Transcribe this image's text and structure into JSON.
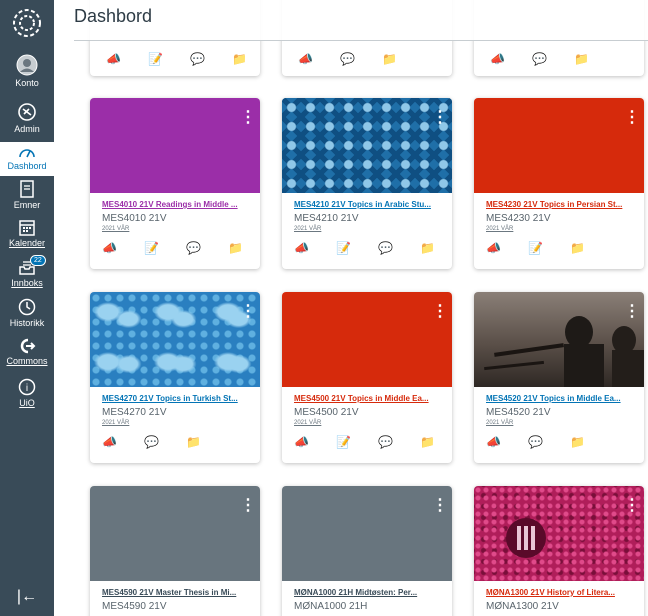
{
  "nav": {
    "account": "Konto",
    "admin": "Admin",
    "dashboard": "Dashbord",
    "courses": "Emner",
    "calendar": "Kalender",
    "inbox": "Innboks",
    "inbox_badge": "22",
    "history": "Historikk",
    "commons": "Commons",
    "uio": "UiO"
  },
  "page": {
    "title": "Dashbord"
  },
  "colors": {
    "nav_bg": "#394b58",
    "purple": "#9b2ea8",
    "red": "#d62a0c",
    "grey": "#68757e",
    "link_blue": "#0374b5"
  },
  "cards": [
    {
      "title": "MES4010 21V Readings in Middle ...",
      "code": "MES4010 21V",
      "term": "2021 VÅR",
      "title_color": "#9b2ea8"
    },
    {
      "title": "MES4210 21V Topics in Arabic Stu...",
      "code": "MES4210 21V",
      "term": "2021 VÅR",
      "title_color": "#0374b5"
    },
    {
      "title": "MES4230 21V Topics in Persian St...",
      "code": "MES4230 21V",
      "term": "2021 VÅR",
      "title_color": "#d62a0c"
    },
    {
      "title": "MES4270 21V Topics in Turkish St...",
      "code": "MES4270 21V",
      "term": "2021 VÅR",
      "title_color": "#0374b5"
    },
    {
      "title": "MES4500 21V Topics in Middle Ea...",
      "code": "MES4500 21V",
      "term": "2021 VÅR",
      "title_color": "#d62a0c"
    },
    {
      "title": "MES4520 21V Topics in Middle Ea...",
      "code": "MES4520 21V",
      "term": "2021 VÅR",
      "title_color": "#0374b5"
    },
    {
      "title": "MES4590 21V Master Thesis in Mi...",
      "code": "MES4590 21V",
      "term": "",
      "title_color": "#394b58"
    },
    {
      "title": "MØNA1000 21H Midtøsten: Per...",
      "code": "MØNA1000 21H",
      "term": "",
      "title_color": "#394b58"
    },
    {
      "title": "MØNA1300 21V History of Litera...",
      "code": "MØNA1300 21V",
      "term": "",
      "title_color": "#d62a0c"
    }
  ]
}
